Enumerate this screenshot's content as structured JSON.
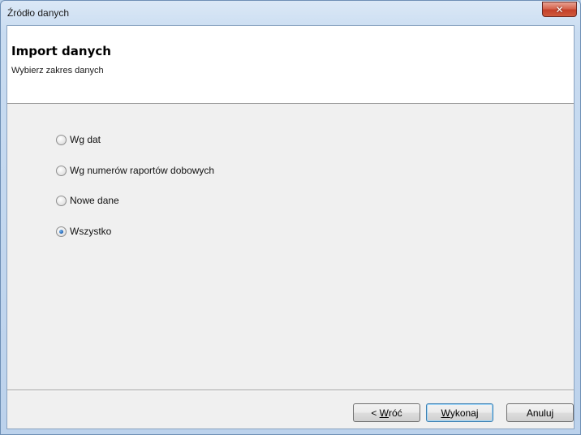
{
  "window": {
    "title": "Źródło danych",
    "close_symbol": "✕"
  },
  "header": {
    "title": "Import danych",
    "subtitle": "Wybierz zakres danych"
  },
  "options": [
    {
      "label": "Wg dat",
      "checked": false
    },
    {
      "label": "Wg numerów raportów dobowych",
      "checked": false
    },
    {
      "label": "Nowe dane",
      "checked": false
    },
    {
      "label": "Wszystko",
      "checked": true
    }
  ],
  "buttons": {
    "back_prefix": "< ",
    "back_mnemonic": "W",
    "back_rest": "róć",
    "execute_mnemonic": "W",
    "execute_rest": "ykonaj",
    "cancel": "Anuluj"
  },
  "colors": {
    "accent": "#3c7fb1",
    "close": "#c4402a"
  }
}
